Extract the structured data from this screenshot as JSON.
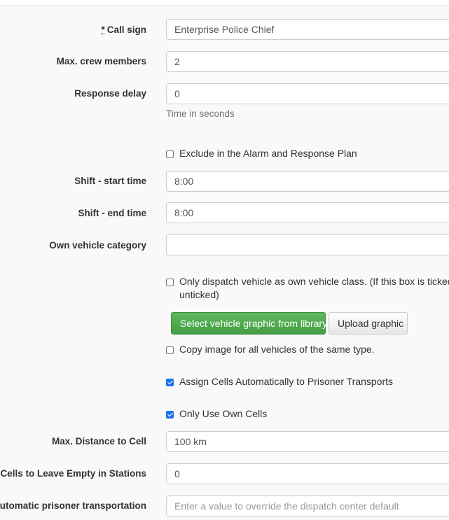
{
  "form": {
    "call_sign": {
      "required_marker": "*",
      "label": "Call sign",
      "value": "Enterprise Police Chief"
    },
    "max_crew": {
      "label": "Max. crew members",
      "value": "2"
    },
    "response_delay": {
      "label": "Response delay",
      "value": "0",
      "help": "Time in seconds"
    },
    "exclude_alarm": {
      "label": "Exclude in the Alarm and Response Plan",
      "checked": false
    },
    "shift_start": {
      "label": "Shift - start time",
      "value": "8:00"
    },
    "shift_end": {
      "label": "Shift - end time",
      "value": "8:00"
    },
    "own_vehicle_category": {
      "label": "Own vehicle category",
      "value": ""
    },
    "only_dispatch_own_class": {
      "label_line1": "Only dispatch vehicle as own vehicle class. (If this box is ticked the",
      "label_line2": "unticked)",
      "checked": false
    },
    "buttons": {
      "select_graphic": "Select vehicle graphic from library",
      "upload_graphic": "Upload graphic"
    },
    "copy_image": {
      "label": "Copy image for all vehicles of the same type.",
      "checked": false
    },
    "assign_cells": {
      "label": "Assign Cells Automatically to Prisoner Transports",
      "checked": true
    },
    "own_cells": {
      "label": "Only Use Own Cells",
      "checked": true
    },
    "max_distance": {
      "label": "Max. Distance to Cell",
      "value": "100 km"
    },
    "cells_empty": {
      "label": "Cells to Leave Empty in Stations",
      "value": "0"
    },
    "auto_transport": {
      "label": "automatic prisoner transportation",
      "placeholder": "Enter a value to override the dispatch center default"
    }
  },
  "colors": {
    "primary_button": "#5cb85c",
    "checkbox_checked": "#1a73e8"
  }
}
